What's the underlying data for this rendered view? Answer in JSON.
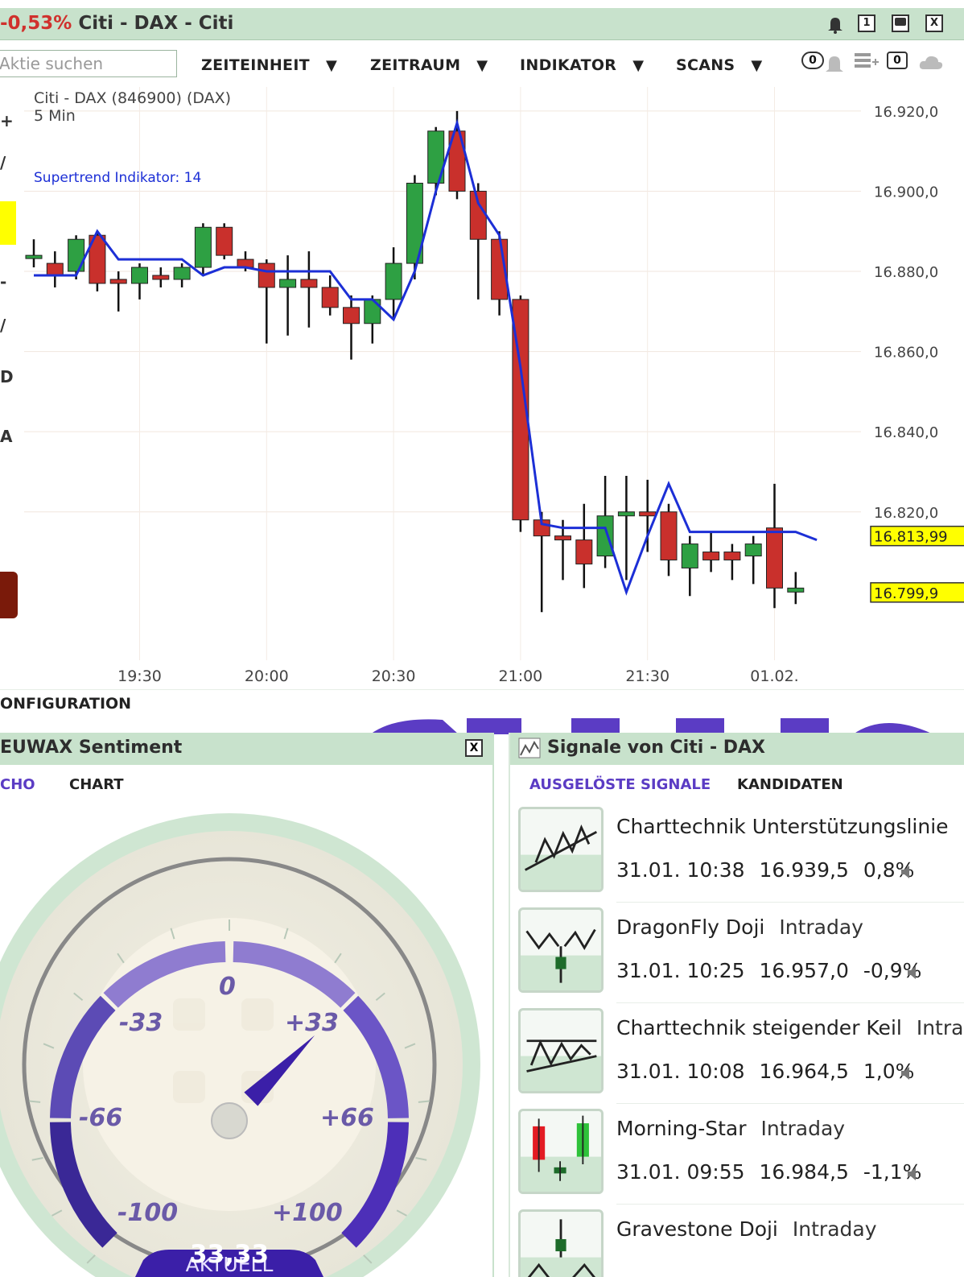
{
  "chart_window": {
    "title_change": "-0,53%",
    "title_text": "Citi - DAX - Citi",
    "btn_minimize": "1",
    "btn_close": "X"
  },
  "toolbar": {
    "search_placeholder": "Aktie suchen",
    "menus": [
      "ZEITEINHEIT",
      "ZEITRAUM",
      "INDIKATOR",
      "SCANS"
    ],
    "menu_arrow": "▼",
    "badge_left": "0",
    "badge_right": "0"
  },
  "left_tools": [
    "+",
    "/",
    "-",
    "/",
    "D",
    "A"
  ],
  "chart_data": {
    "type": "candlestick",
    "title": "Citi - DAX (846900) (DAX)",
    "subtitle": "5 Min",
    "indicator_label": "Supertrend Indikator: 14",
    "ylim": [
      16785,
      16925
    ],
    "y_ticks": [
      "16.920,0",
      "16.900,0",
      "16.880,0",
      "16.860,0",
      "16.840,0",
      "16.820,0"
    ],
    "y_tick_values": [
      16920,
      16900,
      16880,
      16860,
      16840,
      16820
    ],
    "x_ticks": [
      "19:30",
      "20:00",
      "20:30",
      "21:00",
      "21:30",
      "01.02."
    ],
    "x_tick_index": [
      5,
      11,
      17,
      23,
      29,
      35
    ],
    "price_labels": [
      {
        "value": 16813.99,
        "text": "16.813,99"
      },
      {
        "value": 16799.9,
        "text": "16.799,9"
      }
    ],
    "candles": [
      {
        "o": 16884,
        "h": 16888,
        "l": 16881,
        "c": 16884
      },
      {
        "o": 16882,
        "h": 16885,
        "l": 16876,
        "c": 16879
      },
      {
        "o": 16880,
        "h": 16889,
        "l": 16878,
        "c": 16888
      },
      {
        "o": 16889,
        "h": 16890,
        "l": 16875,
        "c": 16877
      },
      {
        "o": 16878,
        "h": 16880,
        "l": 16870,
        "c": 16877
      },
      {
        "o": 16877,
        "h": 16882,
        "l": 16873,
        "c": 16881
      },
      {
        "o": 16879,
        "h": 16881,
        "l": 16876,
        "c": 16878
      },
      {
        "o": 16878,
        "h": 16882,
        "l": 16876,
        "c": 16881
      },
      {
        "o": 16881,
        "h": 16892,
        "l": 16879,
        "c": 16891
      },
      {
        "o": 16891,
        "h": 16892,
        "l": 16883,
        "c": 16884
      },
      {
        "o": 16883,
        "h": 16885,
        "l": 16880,
        "c": 16881
      },
      {
        "o": 16882,
        "h": 16883,
        "l": 16862,
        "c": 16876
      },
      {
        "o": 16876,
        "h": 16884,
        "l": 16864,
        "c": 16878
      },
      {
        "o": 16878,
        "h": 16885,
        "l": 16866,
        "c": 16876
      },
      {
        "o": 16876,
        "h": 16879,
        "l": 16869,
        "c": 16871
      },
      {
        "o": 16871,
        "h": 16874,
        "l": 16858,
        "c": 16867
      },
      {
        "o": 16867,
        "h": 16874,
        "l": 16862,
        "c": 16873
      },
      {
        "o": 16873,
        "h": 16886,
        "l": 16868,
        "c": 16882
      },
      {
        "o": 16882,
        "h": 16904,
        "l": 16878,
        "c": 16902
      },
      {
        "o": 16902,
        "h": 16916,
        "l": 16899,
        "c": 16915
      },
      {
        "o": 16915,
        "h": 16920,
        "l": 16898,
        "c": 16900
      },
      {
        "o": 16900,
        "h": 16902,
        "l": 16873,
        "c": 16888
      },
      {
        "o": 16888,
        "h": 16890,
        "l": 16869,
        "c": 16873
      },
      {
        "o": 16873,
        "h": 16874,
        "l": 16815,
        "c": 16818
      },
      {
        "o": 16818,
        "h": 16820,
        "l": 16795,
        "c": 16814
      },
      {
        "o": 16814,
        "h": 16818,
        "l": 16803,
        "c": 16813
      },
      {
        "o": 16813,
        "h": 16822,
        "l": 16801,
        "c": 16807
      },
      {
        "o": 16809,
        "h": 16829,
        "l": 16806,
        "c": 16819
      },
      {
        "o": 16819,
        "h": 16829,
        "l": 16803,
        "c": 16820
      },
      {
        "o": 16820,
        "h": 16828,
        "l": 16810,
        "c": 16819
      },
      {
        "o": 16820,
        "h": 16822,
        "l": 16804,
        "c": 16808
      },
      {
        "o": 16806,
        "h": 16814,
        "l": 16799,
        "c": 16812
      },
      {
        "o": 16810,
        "h": 16815,
        "l": 16805,
        "c": 16808
      },
      {
        "o": 16810,
        "h": 16812,
        "l": 16803,
        "c": 16808
      },
      {
        "o": 16809,
        "h": 16814,
        "l": 16802,
        "c": 16812
      },
      {
        "o": 16816,
        "h": 16827,
        "l": 16796,
        "c": 16801
      },
      {
        "o": 16800,
        "h": 16805,
        "l": 16797,
        "c": 16801
      }
    ],
    "supertrend": [
      16879,
      16879,
      16879,
      16890,
      16883,
      16883,
      16883,
      16883,
      16879,
      16881,
      16881,
      16880,
      16880,
      16880,
      16880,
      16873,
      16873,
      16868,
      16880,
      16900,
      16917,
      16897,
      16889,
      16856,
      16817,
      16816,
      16816,
      16816,
      16800,
      16814,
      16827,
      16815,
      16815,
      16815,
      16815,
      16815,
      16815,
      16813
    ]
  },
  "config_label": "ONFIGURATION",
  "sentiment": {
    "title": "EUWAX Sentiment",
    "close": "X",
    "tabs": [
      "CHO",
      "CHART"
    ],
    "gauge_labels": {
      "zero": "0",
      "m33": "-33",
      "p33": "+33",
      "m66": "-66",
      "p66": "+66",
      "m100": "-100",
      "p100": "+100"
    },
    "aktuell_label": "AKTUELL",
    "aktuell_value": "33,33",
    "needle_value": 33.33
  },
  "signals": {
    "title": "Signale von Citi - DAX",
    "tabs": [
      "AUSGELÖSTE SIGNALE",
      "KANDIDATEN"
    ],
    "items": [
      {
        "name": "Charttechnik Unterstützungslinie",
        "type": "",
        "date": "31.01. 10:38",
        "price": "16.939,5",
        "change": "0,8%",
        "icon": "support-line-icon"
      },
      {
        "name": "DragonFly Doji",
        "type": "Intraday",
        "date": "31.01. 10:25",
        "price": "16.957,0",
        "change": "-0,9%",
        "icon": "dragonfly-doji-icon"
      },
      {
        "name": "Charttechnik steigender Keil",
        "type": "Intra",
        "date": "31.01. 10:08",
        "price": "16.964,5",
        "change": "1,0%",
        "icon": "rising-wedge-icon"
      },
      {
        "name": "Morning-Star",
        "type": "Intraday",
        "date": "31.01. 09:55",
        "price": "16.984,5",
        "change": "-1,1%",
        "icon": "morning-star-icon"
      },
      {
        "name": "Gravestone Doji",
        "type": "Intraday",
        "date": "",
        "price": "",
        "change": "",
        "icon": "gravestone-doji-icon"
      }
    ]
  },
  "colors": {
    "up": "#2ea043",
    "down": "#c9302c",
    "supertrend": "#1c2fd6",
    "panel_header": "#c8e2cc",
    "accent_purple": "#5b3cc4"
  }
}
